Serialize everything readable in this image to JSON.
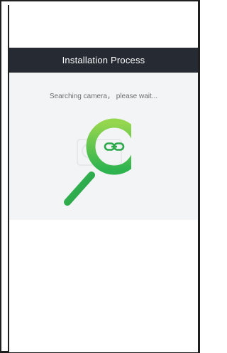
{
  "header": {
    "title": "Installation Process"
  },
  "main": {
    "status_text": "Searching camera， please wait..."
  },
  "colors": {
    "header_bg": "#252a33",
    "content_bg": "#f3f4f5",
    "ring_light": "#8fd44f",
    "ring_dark": "#2db34f",
    "icon_green": "#2aa84a"
  },
  "icons": {
    "graphic": "magnifier-icon",
    "link": "link-icon",
    "background_device": "camera-outline-icon"
  }
}
